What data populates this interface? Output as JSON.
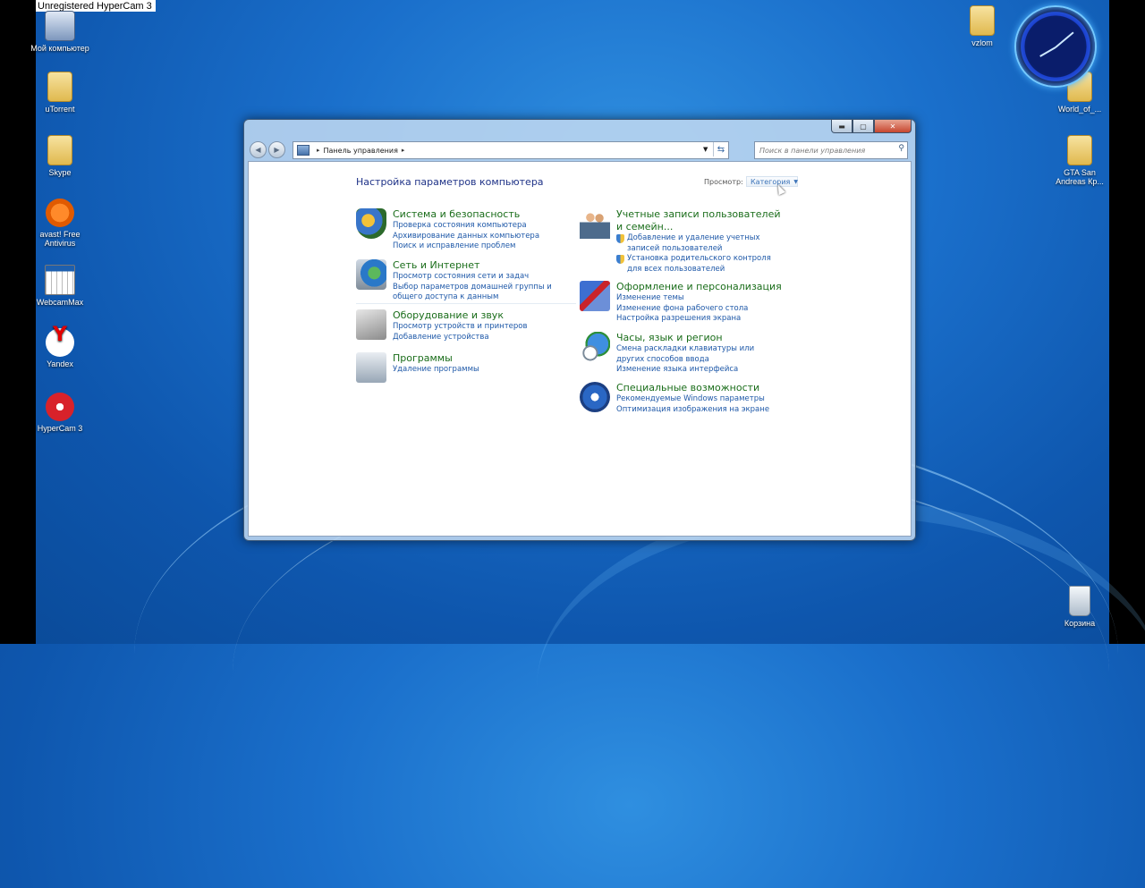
{
  "watermark": "Unregistered HyperCam 3",
  "desktop_icons": [
    {
      "label": "Мой компьютер",
      "icon": "computer-icon"
    },
    {
      "label": "uTorrent",
      "icon": "utorrent-icon"
    },
    {
      "label": "Skype",
      "icon": "skype-icon"
    },
    {
      "label": "avast! Free Antivirus",
      "icon": "avast-icon"
    },
    {
      "label": "WebcamMax",
      "icon": "webcammax-icon"
    },
    {
      "label": "Yandex",
      "icon": "yandex-icon"
    },
    {
      "label": "HyperCam 3",
      "icon": "hypercam-icon"
    },
    {
      "label": "vzlom",
      "icon": "folder-icon"
    },
    {
      "label": "World_of_...",
      "icon": "folder-icon"
    },
    {
      "label": "GTA San Andreas Кр...",
      "icon": "folder-icon"
    },
    {
      "label": "Корзина",
      "icon": "recycle-bin-icon"
    }
  ],
  "window": {
    "breadcrumb": "Панель управления",
    "search_placeholder": "Поиск в панели управления",
    "title": "Настройка параметров компьютера",
    "view_label": "Просмотр:",
    "view_value": "Категория",
    "left_categories": [
      {
        "heading": "Система и безопасность",
        "links": [
          "Проверка состояния компьютера",
          "Архивирование данных компьютера",
          "Поиск и исправление проблем"
        ]
      },
      {
        "heading": "Сеть и Интернет",
        "links": [
          "Просмотр состояния сети и задач",
          "Выбор параметров домашней группы и общего доступа к данным"
        ]
      },
      {
        "heading": "Оборудование и звук",
        "links": [
          "Просмотр устройств и принтеров",
          "Добавление устройства"
        ]
      },
      {
        "heading": "Программы",
        "links": [
          "Удаление программы"
        ]
      }
    ],
    "right_categories": [
      {
        "heading": "Учетные записи пользователей и семейн...",
        "links": [
          "Добавление и удаление учетных записей пользователей",
          "Установка родительского контроля для всех пользователей"
        ]
      },
      {
        "heading": "Оформление и персонализация",
        "links": [
          "Изменение темы",
          "Изменение фона рабочего стола",
          "Настройка разрешения экрана"
        ]
      },
      {
        "heading": "Часы, язык и регион",
        "links": [
          "Смена раскладки клавиатуры или других способов ввода",
          "Изменение языка интерфейса"
        ]
      },
      {
        "heading": "Специальные возможности",
        "links": [
          "Рекомендуемые Windows параметры",
          "Оптимизация изображения на экране"
        ]
      }
    ]
  }
}
